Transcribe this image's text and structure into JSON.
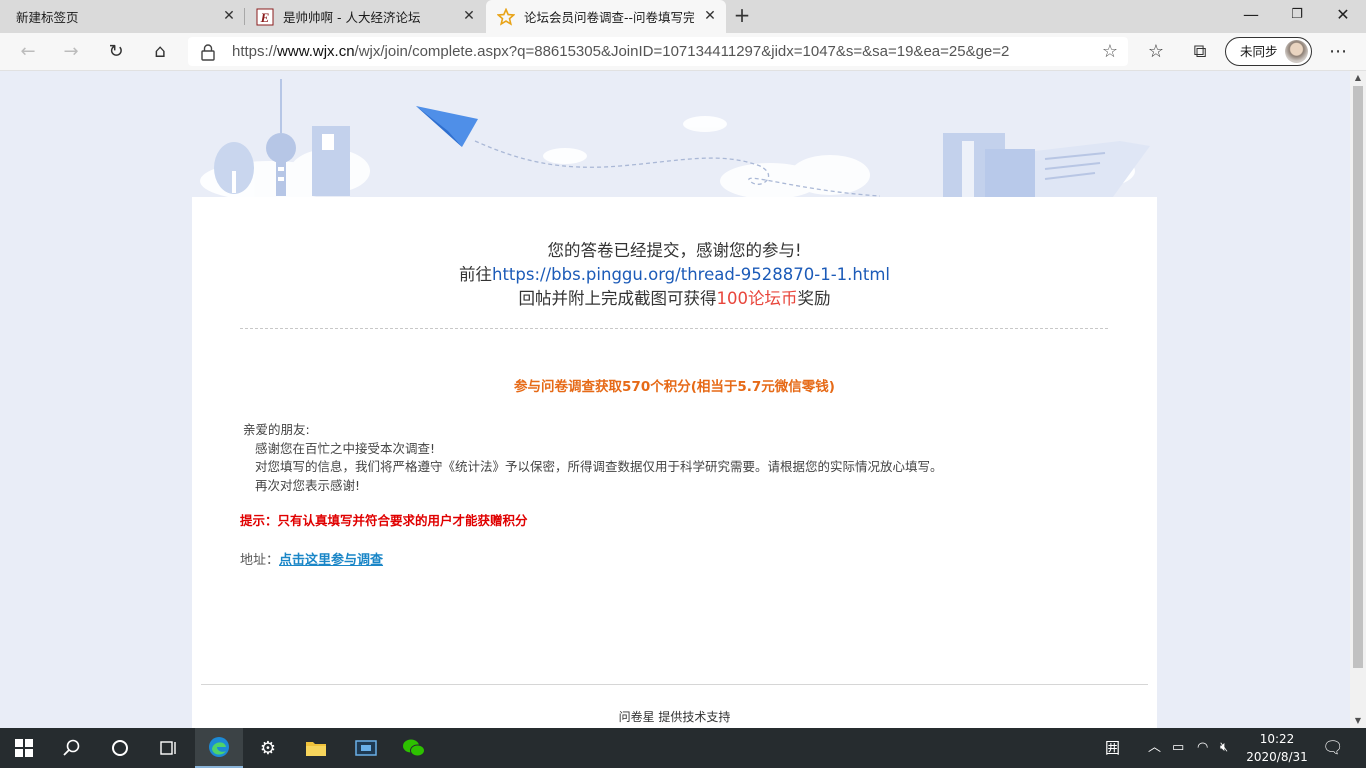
{
  "browser": {
    "tabs": [
      {
        "label": "新建标签页"
      },
      {
        "label": "是帅帅啊 - 人大经济论坛"
      },
      {
        "label": "论坛会员问卷调查--问卷填写完成"
      }
    ],
    "url_prefix": "https://",
    "url_host": "www.wjx.cn",
    "url_path": "/wjx/join/complete.aspx?q=88615305&JoinID=107134411297&jidx=1047&s=&sa=19&ea=25&ge=2",
    "sync_label": "未同步"
  },
  "page": {
    "line1": "您的答卷已经提交，感谢您的参与!",
    "line2_prefix": "前往",
    "line2_link": "https://bbs.pinggu.org/thread-9528870-1-1.html",
    "line3_prefix": "回帖并附上完成截图可获得",
    "line3_reward": "100论坛币",
    "line3_suffix": "奖励",
    "points_text": "参与问卷调查获取570个积分(相当于5.7元微信零钱)",
    "greeting": "亲爱的朋友:",
    "letter_lines": [
      "感谢您在百忙之中接受本次调查!",
      "对您填写的信息，我们将严格遵守《统计法》予以保密，所得调查数据仅用于科学研究需要。请根据您的实际情况放心填写。",
      "再次对您表示感谢!"
    ],
    "tip": "提示：只有认真填写并符合要求的用户才能获赠积分",
    "address_label": "地址：",
    "address_link": "点击这里参与调查",
    "powered_by": "问卷星 提供技术支持"
  },
  "taskbar": {
    "time": "10:22",
    "date": "2020/8/31"
  }
}
